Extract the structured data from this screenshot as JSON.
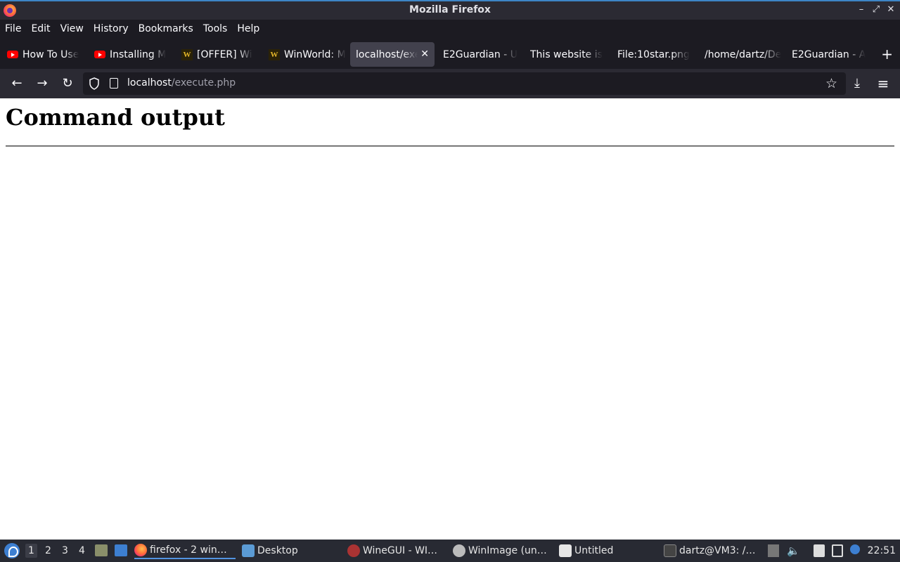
{
  "window": {
    "title": "Mozilla Firefox",
    "controls": {
      "minimize": "–",
      "maximize": "⤢",
      "close": "✕"
    }
  },
  "menubar": {
    "items": [
      "File",
      "Edit",
      "View",
      "History",
      "Bookmarks",
      "Tools",
      "Help"
    ]
  },
  "tabs": [
    {
      "label": "How To Use",
      "icon": "youtube-icon",
      "active": false
    },
    {
      "label": "Installing M",
      "icon": "youtube-icon",
      "active": false
    },
    {
      "label": "[OFFER] Wi",
      "icon": "winworld-icon",
      "active": false
    },
    {
      "label": "WinWorld: M",
      "icon": "winworld-icon",
      "active": false
    },
    {
      "label": "localhost/exe",
      "icon": "",
      "active": true
    },
    {
      "label": "E2Guardian - U",
      "icon": "",
      "active": false
    },
    {
      "label": "This website is",
      "icon": "",
      "active": false
    },
    {
      "label": "File:10star.png",
      "icon": "",
      "active": false
    },
    {
      "label": "/home/dartz/De",
      "icon": "",
      "active": false
    },
    {
      "label": "E2Guardian - A",
      "icon": "",
      "active": false
    }
  ],
  "navbar": {
    "back": "←",
    "forward": "→",
    "reload": "↻",
    "url_host": "localhost",
    "url_path": "/execute.php",
    "bookmark_star": "☆",
    "downloads": "⤓",
    "menu": "≡"
  },
  "page": {
    "heading": "Command output"
  },
  "taskbar": {
    "workspaces": [
      "1",
      "2",
      "3",
      "4"
    ],
    "tasks": [
      {
        "label": "firefox - 2 win…",
        "active": true
      },
      {
        "label": "Desktop",
        "active": false
      },
      {
        "label": "WineGUI - WI…",
        "active": false
      },
      {
        "label": "WinImage (un…",
        "active": false
      },
      {
        "label": "Untitled",
        "active": false
      },
      {
        "label": "dartz@VM3: /…",
        "active": false
      }
    ],
    "clock": "22:51"
  },
  "colors": {
    "accent": "#3d85c6",
    "tab_active_bg": "#42414d",
    "toolbar_bg": "#2b2a33",
    "taskbar_bg": "#282a33"
  }
}
